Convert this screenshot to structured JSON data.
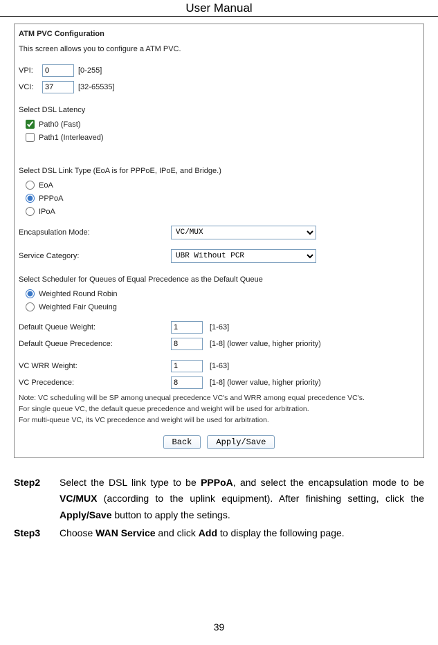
{
  "header": {
    "title": "User Manual"
  },
  "screenshot": {
    "section_title": "ATM PVC Configuration",
    "intro": "This screen allows you to configure a ATM PVC.",
    "vpi": {
      "label": "VPI:",
      "value": "0",
      "hint": "[0-255]"
    },
    "vci": {
      "label": "VCI:",
      "value": "37",
      "hint": "[32-65535]"
    },
    "latency": {
      "label": "Select DSL Latency",
      "path0": {
        "label": "Path0 (Fast)",
        "checked": true
      },
      "path1": {
        "label": "Path1 (Interleaved)",
        "checked": false
      }
    },
    "linktype": {
      "label": "Select DSL Link Type (EoA is for PPPoE, IPoE, and Bridge.)",
      "eoa": {
        "label": "EoA"
      },
      "pppoa": {
        "label": "PPPoA"
      },
      "ipoa": {
        "label": "IPoA"
      }
    },
    "encap": {
      "label": "Encapsulation Mode:",
      "value": "VC/MUX"
    },
    "svccat": {
      "label": "Service Category:",
      "value": "UBR Without PCR"
    },
    "scheduler": {
      "label": "Select Scheduler for Queues of Equal Precedence as the Default Queue",
      "wrr": {
        "label": "Weighted Round Robin"
      },
      "wfq": {
        "label": "Weighted Fair Queuing"
      }
    },
    "dq_weight": {
      "label": "Default Queue Weight:",
      "value": "1",
      "hint": "[1-63]"
    },
    "dq_prec": {
      "label": "Default Queue Precedence:",
      "value": "8",
      "hint": "[1-8] (lower value, higher priority)"
    },
    "vc_wrr": {
      "label": "VC WRR Weight:",
      "value": "1",
      "hint": "[1-63]"
    },
    "vc_prec": {
      "label": "VC Precedence:",
      "value": "8",
      "hint": "[1-8] (lower value, higher priority)"
    },
    "note_l1": "Note: VC scheduling will be SP among unequal precedence VC's and WRR among equal precedence VC's.",
    "note_l2": "For single queue VC, the default queue precedence and weight will be used for arbitration.",
    "note_l3": "For multi-queue VC, its VC precedence and weight will be used for arbitration.",
    "btn_back": "Back",
    "btn_apply": "Apply/Save"
  },
  "steps": {
    "s2": {
      "label": "Step2",
      "t1": "Select  the  DSL  link  type  to  be  ",
      "b1": "PPPoA",
      "t2": ",  and  select  the  encapsulation mode to be ",
      "b2": "VC/MUX",
      "t3": " (according to the uplink equipment). After finishing setting, click the ",
      "b3": "Apply/Save",
      "t4": " button to apply the setings."
    },
    "s3": {
      "label": "Step3",
      "t1": "Choose ",
      "b1": "WAN Service",
      "t2": " and click ",
      "b2": "Add",
      "t3": " to display the following page."
    }
  },
  "page_number": "39"
}
